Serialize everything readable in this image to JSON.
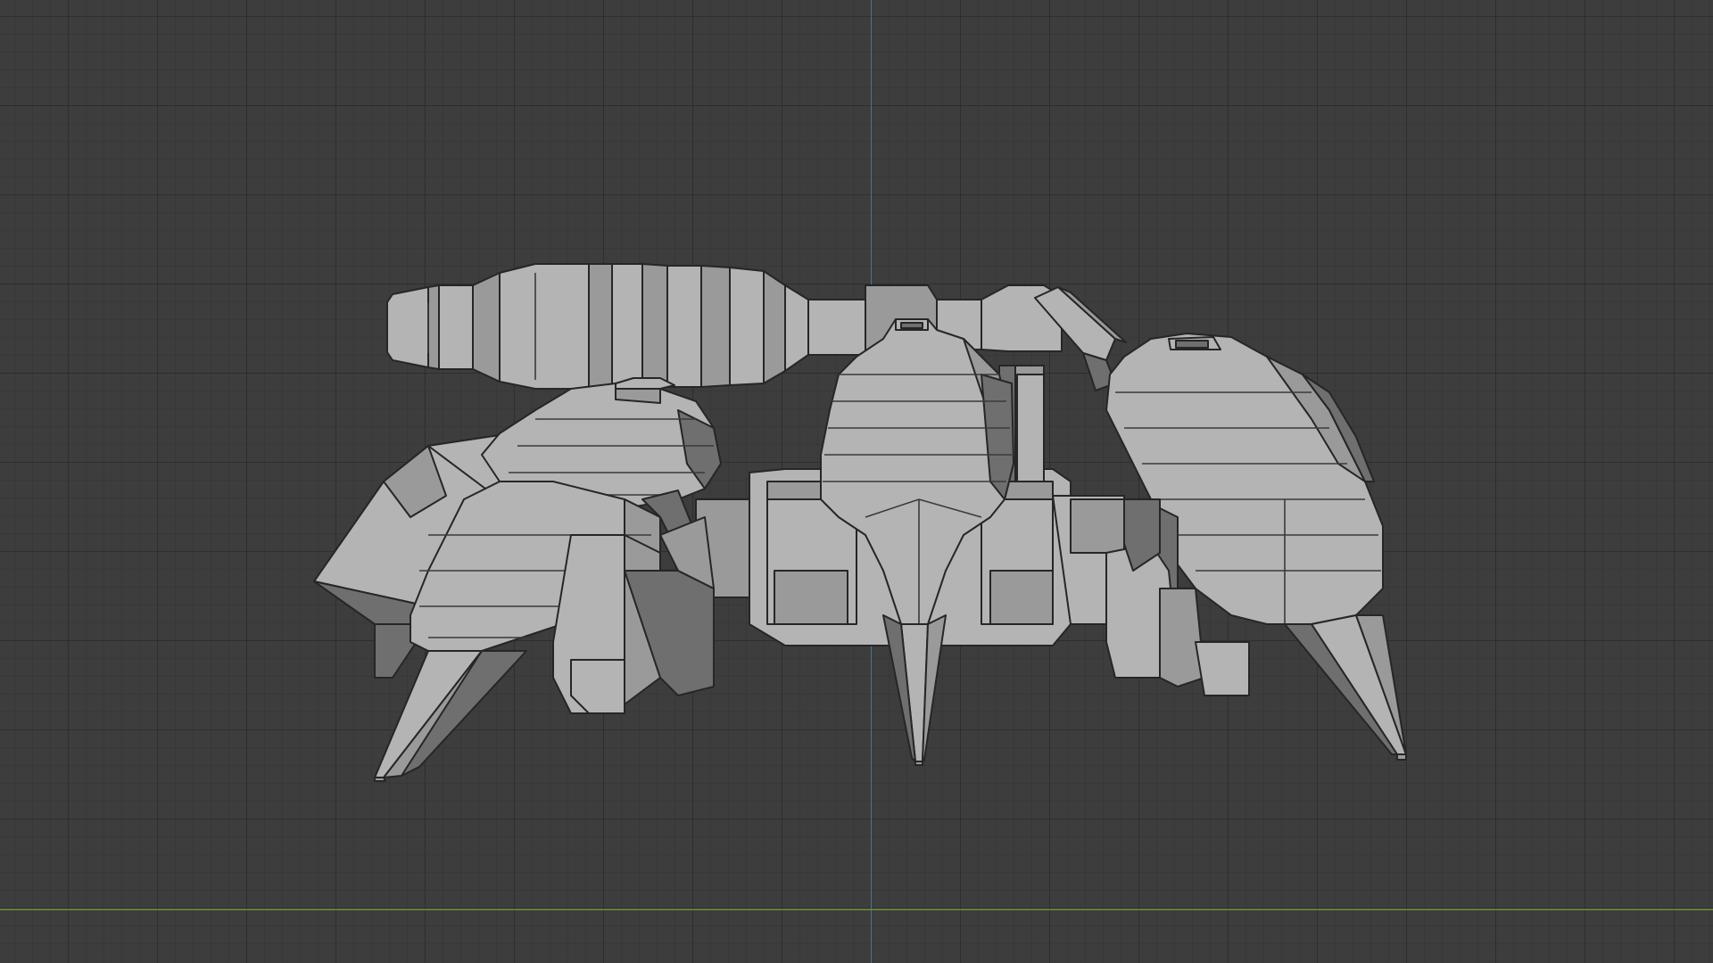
{
  "viewport": {
    "background": "#3d3d3d",
    "grid_color": "#333333",
    "axis_y_color": "#4f7fa8",
    "axis_x_color": "#6a8a3a"
  },
  "model": {
    "icon": "mech-crab-mesh",
    "base_color": "#b4b4b4",
    "shadow_color": "#6f6f6f"
  }
}
